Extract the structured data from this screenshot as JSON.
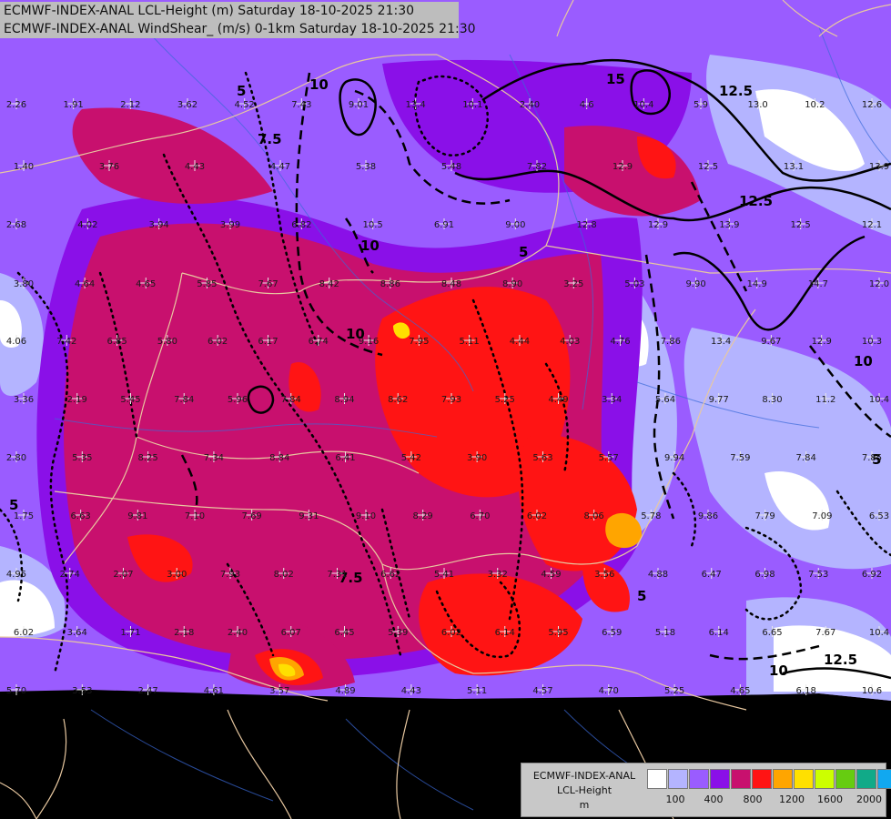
{
  "header": {
    "line1": "ECMWF-INDEX-ANAL LCL-Height (m) Saturday 18-10-2025 21:30",
    "line2": "ECMWF-INDEX-ANAL WindShear_ (m/s) 0-1km Saturday 18-10-2025 21:30"
  },
  "legend": {
    "title1": "ECMWF-INDEX-ANAL",
    "title2": "LCL-Height",
    "unit": "m",
    "colors": [
      "#ffffff",
      "#b4b4ff",
      "#9a5cff",
      "#8a10e8",
      "#c8106e",
      "#ff1414",
      "#ffa500",
      "#ffe000",
      "#ccff00",
      "#66cc11",
      "#11aa88",
      "#11a8f0"
    ],
    "tick_labels": [
      "100",
      "400",
      "800",
      "1200",
      "1600",
      "2000"
    ]
  },
  "colors": {
    "no_data": "#000000",
    "border": "#e8c8a0",
    "river": "#3a6ad8",
    "contour": "#000000"
  },
  "contour_labels": [
    "5",
    "7.5",
    "10",
    "12.5",
    "15"
  ],
  "station_values": [
    "2.26",
    "1.91",
    "2.12",
    "3.62",
    "4.52",
    "7.43",
    "9.01",
    "13.4",
    "10.1",
    "2.40",
    "4.6",
    "10.4",
    "5.9",
    "13.0",
    "10.2",
    "12.6",
    "1.40",
    "3.76",
    "4.43",
    "4.47",
    "5.38",
    "5.48",
    "7.82",
    "12.9",
    "12.5",
    "13.1",
    "13.9",
    "2.68",
    "4.02",
    "3.94",
    "3.99",
    "6.82",
    "10.5",
    "6.91",
    "9.00",
    "12.8",
    "12.9",
    "13.9",
    "12.5",
    "12.1",
    "3.80",
    "4.64",
    "4.65",
    "5.85",
    "7.67",
    "8.42",
    "8.86",
    "8.48",
    "8.90",
    "3.25",
    "5.03",
    "9.90",
    "14.9",
    "14.7",
    "12.0",
    "4.06",
    "7.42",
    "6.85",
    "5.80",
    "6.02",
    "6.17",
    "6.74",
    "9.16",
    "7.95",
    "5.11",
    "4.44",
    "4.03",
    "4.76",
    "7.86",
    "13.4",
    "9.67",
    "12.9",
    "10.3",
    "3.36",
    "2.19",
    "5.45",
    "7.84",
    "5.96",
    "7.84",
    "8.94",
    "8.62",
    "7.93",
    "5.25",
    "4.49",
    "3.34",
    "5.64",
    "9.77",
    "8.30",
    "11.2",
    "10.4",
    "2.80",
    "5.35",
    "8.25",
    "7.34",
    "8.84",
    "6.41",
    "5.42",
    "3.90",
    "5.63",
    "5.57",
    "9.94",
    "7.59",
    "7.84",
    "7.85",
    "1.75",
    "6.63",
    "9.81",
    "7.10",
    "7.69",
    "9.31",
    "9.10",
    "8.29",
    "6.70",
    "6.02",
    "8.06",
    "5.78",
    "9.86",
    "7.79",
    "7.09",
    "6.53",
    "4.95",
    "2.74",
    "2.07",
    "3.00",
    "7.93",
    "8.02",
    "7.31",
    "6.62",
    "5.41",
    "3.32",
    "4.59",
    "3.56",
    "4.88",
    "6.47",
    "6.98",
    "7.53",
    "6.92",
    "6.02",
    "3.64",
    "1.71",
    "2.18",
    "2.40",
    "6.07",
    "6.45",
    "5.39",
    "6.02",
    "6.14",
    "5.95",
    "6.59",
    "5.18",
    "6.14",
    "6.65",
    "7.67",
    "10.4",
    "5.70",
    "3.53",
    "2.47",
    "4.61",
    "3.57",
    "4.89",
    "4.43",
    "5.11",
    "4.57",
    "4.70",
    "5.25",
    "4.65",
    "6.18",
    "10.6"
  ]
}
